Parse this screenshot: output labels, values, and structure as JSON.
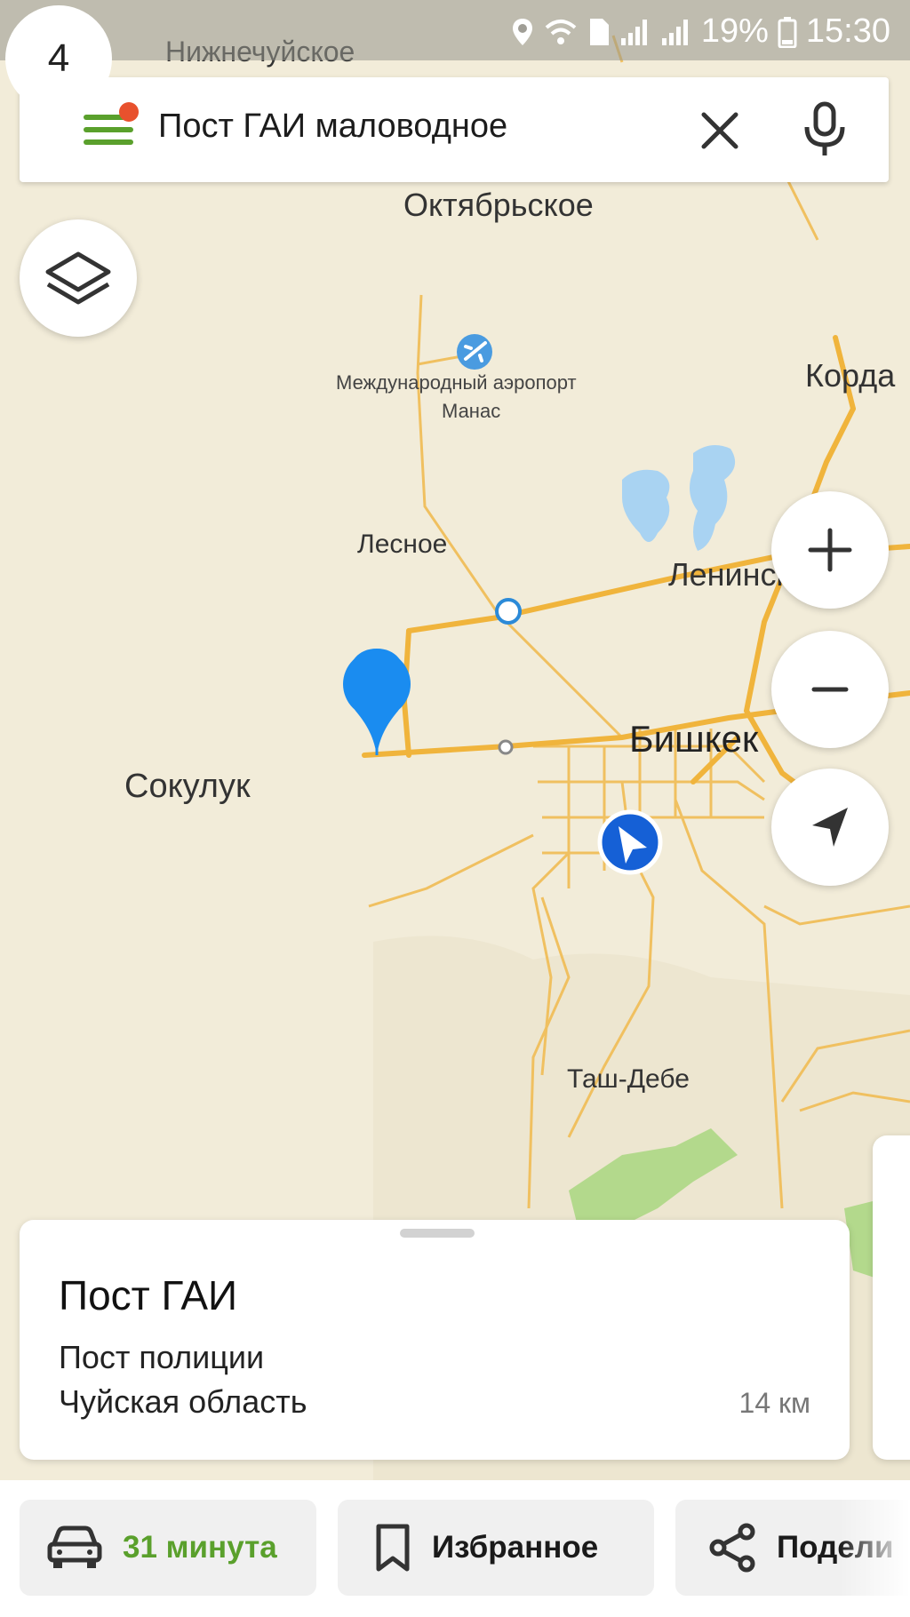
{
  "status_bar": {
    "battery": "19%",
    "time": "15:30"
  },
  "search": {
    "query": "Пост ГАИ маловодное"
  },
  "map": {
    "labels": {
      "nizhnechuiskoe": "Нижнечуйское",
      "oktyabrskoe": "Октябрьское",
      "airport_line1": "Международный аэропорт",
      "airport_line2": "Манас",
      "korday": "Корда",
      "lesnoe": "Лесное",
      "leninskoe": "Ленинское",
      "bishkek": "Бишкек",
      "sokuluk": "Сокулук",
      "tash_debe": "Таш-Дебе"
    },
    "results_count": "4"
  },
  "card": {
    "title": "Пост ГАИ",
    "category": "Пост полиции",
    "region": "Чуйская область",
    "distance": "14 км"
  },
  "actions": {
    "route_label": "31 минута",
    "favorite_label": "Избранное",
    "share_label": "Подели"
  },
  "icons": {
    "menu": "menu-icon",
    "clear": "close-icon",
    "mic": "microphone-icon",
    "layers": "layers-icon",
    "zoom_in": "plus-icon",
    "zoom_out": "minus-icon",
    "locate": "navigation-arrow-icon",
    "car": "car-icon",
    "bookmark": "bookmark-icon",
    "share": "share-icon",
    "airport": "airplane-icon",
    "pin": "map-pin-icon"
  },
  "colors": {
    "accent_green": "#5aa02c",
    "road": "#f0b43c",
    "water": "#a9d3f2",
    "park": "#b3d98c",
    "pin_blue": "#1a8cf0",
    "user_blue": "#1560d6",
    "badge_yellow": "#ffcc33"
  }
}
